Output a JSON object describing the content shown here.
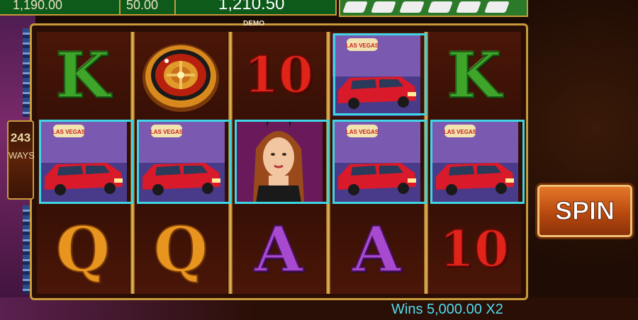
{
  "meters": {
    "credit": "1,190.00",
    "bet": "50.00",
    "total": "1,210.50"
  },
  "demo_label": "DEMO",
  "ways": {
    "number": "243",
    "word": "WAYS"
  },
  "reels": [
    [
      "K",
      "limo",
      "Q"
    ],
    [
      "roulette",
      "limo",
      "Q"
    ],
    [
      "10",
      "showgirl",
      "A"
    ],
    [
      "limo",
      "limo",
      "A"
    ],
    [
      "K",
      "limo",
      "10"
    ]
  ],
  "symbols": {
    "K": "K",
    "Q": "Q",
    "A": "A",
    "10": "10",
    "vegas_sign": "LAS VEGAS"
  },
  "spin": {
    "label": "SPIN"
  },
  "win_status": "Wins 5,000.00 X2",
  "colors": {
    "highlight": "#3fd6e4",
    "frame_gold": "#c89a3a",
    "meter_green": "#0d5a1a"
  }
}
